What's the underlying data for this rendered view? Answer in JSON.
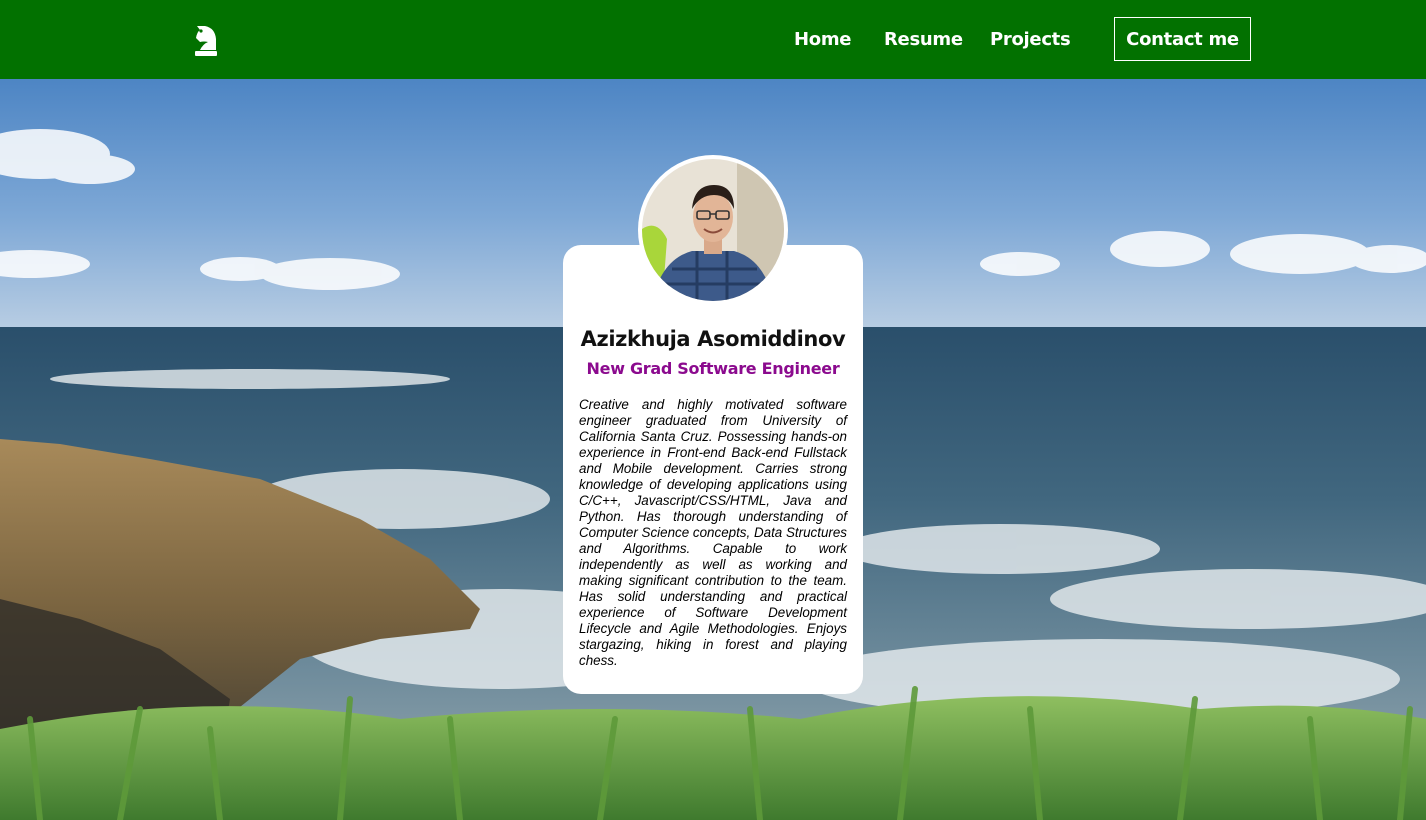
{
  "navbar": {
    "logo_icon": "chess-knight-icon",
    "background_color": "#027100",
    "links": [
      "Home",
      "Resume",
      "Projects"
    ],
    "contact_label": "Contact me"
  },
  "profile": {
    "name": "Azizkhuja Asomiddinov",
    "title": "New Grad Software Engineer",
    "title_color": "#8b0a8e",
    "bio": "Creative and highly motivated software engineer graduated from University of California Santa Cruz. Possessing hands-on experience in Front-end Back-end Fullstack and Mobile development. Carries strong knowledge of developing applications using C/C++, Javascript/CSS/HTML, Java and Python. Has thorough understanding of Computer Science concepts, Data Structures and Algorithms. Capable to work independently as well as working and making significant contribution to the team. Has solid understanding and practical experience of Software Development Lifecycle and Agile Methodologies. Enjoys stargazing, hiking in forest and playing chess."
  }
}
